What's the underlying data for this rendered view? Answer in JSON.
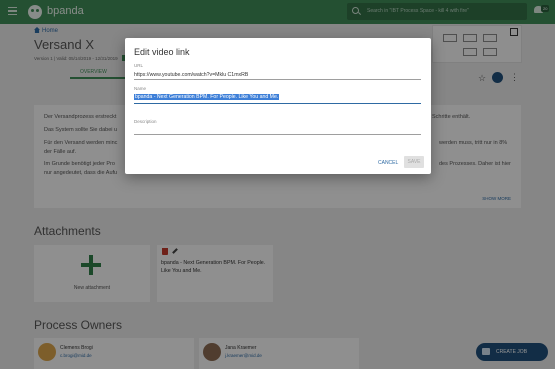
{
  "app": {
    "brand": "bpanda",
    "search_placeholder": "Search in \"IBT Process Space - kill 4 with fire\"",
    "badge": "20"
  },
  "header": {
    "breadcrumb": "Home",
    "title": "Versand X",
    "version": "Version 1 | Valid: 05/14/2019 - 12/31/2019",
    "tab": "OVERVIEW"
  },
  "description": {
    "lines": [
      "Der Versandprozess erstreckt",
      "Das System sollte Sie dabei u",
      "Für den Versand werden minc",
      "der Fälle auf.",
      "Im Grunde benötigt jeder Pro",
      "nur angedeutet, dass die Aufu"
    ],
    "right_lines": [
      "Schritte enthält.",
      "werden muss, tritt nur in 8%",
      "des Prozesses. Daher ist hier"
    ],
    "show_more": "SHOW MORE"
  },
  "attachments": {
    "title": "Attachments",
    "new_label": "New attachment",
    "item_text": "bpanda - Next Generation BPM. For People. Like You and Me."
  },
  "owners": {
    "title": "Process Owners",
    "people": [
      {
        "name": "Clemens Brogi",
        "email": "c.brogi@mid.de"
      },
      {
        "name": "Jana Kraemer",
        "email": "j.kraemer@mid.de"
      }
    ]
  },
  "create_job": "CREATE JOB",
  "dialog": {
    "title": "Edit video link",
    "url_label": "URL",
    "url_value": "https://www.youtube.com/watch?v=Mklu C1mxRB",
    "name_label": "Name",
    "name_value": "bpanda - Next Generation BPM. For People. Like You and Me.",
    "description_label": "Description",
    "description_value": "",
    "cancel": "CANCEL",
    "save": "SAVE"
  },
  "colors": {
    "brand_green": "#3f8a57",
    "accent_blue": "#2e6aa3",
    "job_blue": "#1f4e79"
  }
}
